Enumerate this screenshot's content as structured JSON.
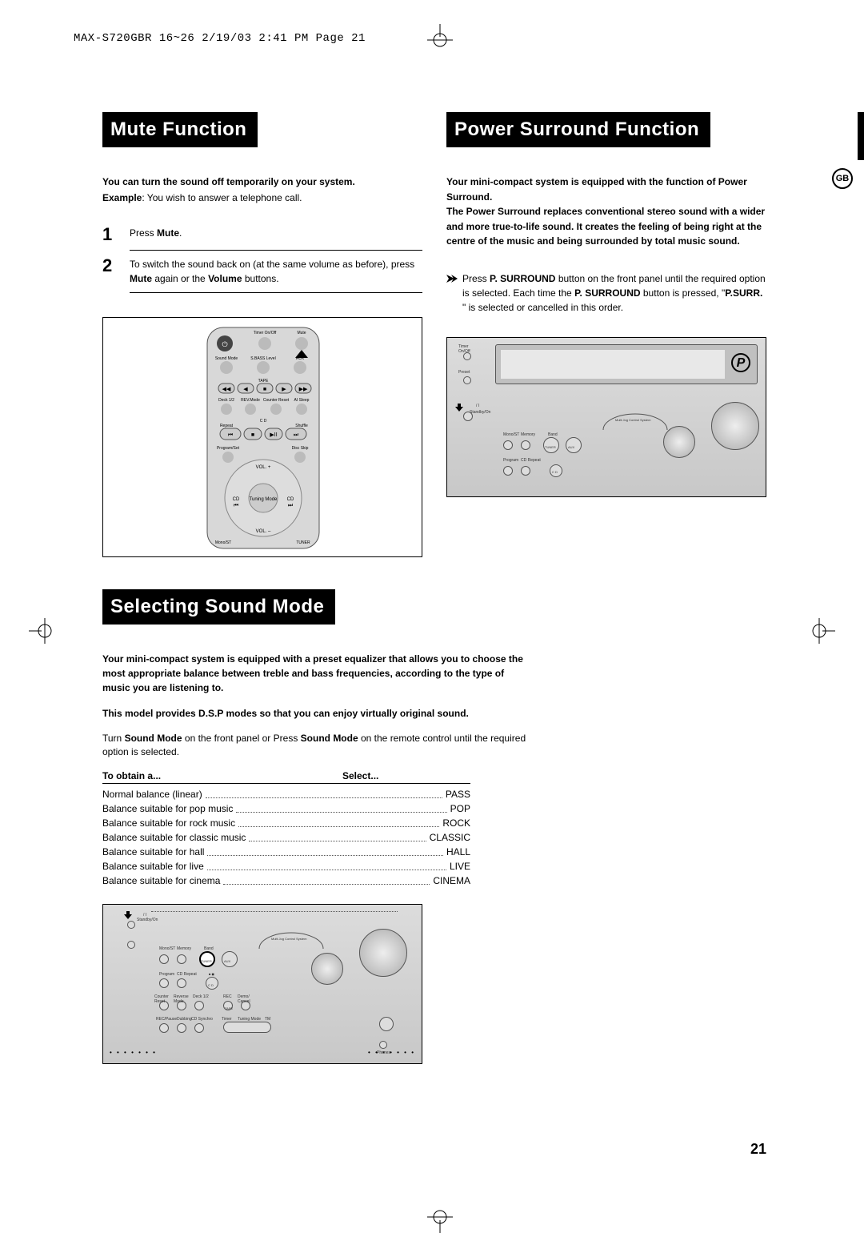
{
  "header": "MAX-S720GBR 16~26  2/19/03 2:41 PM  Page 21",
  "badge": "GB",
  "page_number": "21",
  "mute": {
    "heading": "Mute Function",
    "intro": "You can turn the sound off temporarily on your system.",
    "example_label": "Example",
    "example_text": ": You wish to answer a telephone call.",
    "step1_a": "Press ",
    "step1_b": "Mute",
    "step1_c": ".",
    "step2_a": "To switch the sound back on (at the same volume as before), press ",
    "step2_b": "Mute",
    "step2_c": " again or the ",
    "step2_d": "Volume",
    "step2_e": " buttons."
  },
  "remote_labels": {
    "timer": "Timer On/Off",
    "mute": "Mute",
    "sound_mode": "Sound Mode",
    "sbass": "S.BASS Level",
    "aux": "AUX",
    "tape": "TAPE",
    "deck": "Deck 1/2",
    "rev": "REV.Mode",
    "counter": "Counter Reset",
    "sleep": "AI Sleep",
    "cd": "C D",
    "repeat": "Repeat",
    "shuffle": "Shuffle",
    "program": "Program/Set",
    "discskip": "Disc Skip",
    "volup": "VOL. +",
    "voldn": "VOL. –",
    "tuning": "Tuning Mode",
    "cd_l": "CD",
    "cd_r": "CD",
    "mono": "Mono/ST",
    "tuner": "TUNER"
  },
  "surround": {
    "heading": "Power Surround Function",
    "intro": "Your mini-compact system is equipped with the function of Power Surround.\nThe Power Surround replaces conventional stereo sound with a wider and more true-to-life sound. It creates the feeling of being right at the centre of the music and being surrounded by total music sound.",
    "step_a": "Press ",
    "step_b": "P. SURROUND",
    "step_c": " button on the front panel until the required option is selected. Each time the ",
    "step_d": "P. SURROUND",
    "step_e": " button is pressed, \"",
    "step_f": "P.SURR.",
    "step_g": " \" is selected or cancelled in this order."
  },
  "sound": {
    "heading": "Selecting  Sound Mode",
    "intro1": "Your mini-compact system is equipped with a preset equalizer that allows you to choose the most appropriate balance between treble and bass frequencies, according to the type of music you are listening to.",
    "intro2": "This model provides D.S.P modes so that you can enjoy virtually original sound.",
    "turn_a": "Turn ",
    "turn_b": "Sound Mode",
    "turn_c": " on the front panel or  Press ",
    "turn_d": "Sound Mode",
    "turn_e": " on the remote control until the required option is selected.",
    "th1": "To obtain a...",
    "th2": "Select...",
    "rows": [
      {
        "label": "Normal balance (linear)",
        "value": "PASS"
      },
      {
        "label": "Balance suitable for pop music",
        "value": "POP"
      },
      {
        "label": "Balance suitable for rock music",
        "value": "ROCK"
      },
      {
        "label": "Balance suitable for classic music",
        "value": "CLASSIC"
      },
      {
        "label": "Balance suitable for hall",
        "value": "HALL"
      },
      {
        "label": "Balance suitable for live",
        "value": "LIVE"
      },
      {
        "label": "Balance suitable for cinema",
        "value": "CINEMA"
      }
    ]
  }
}
